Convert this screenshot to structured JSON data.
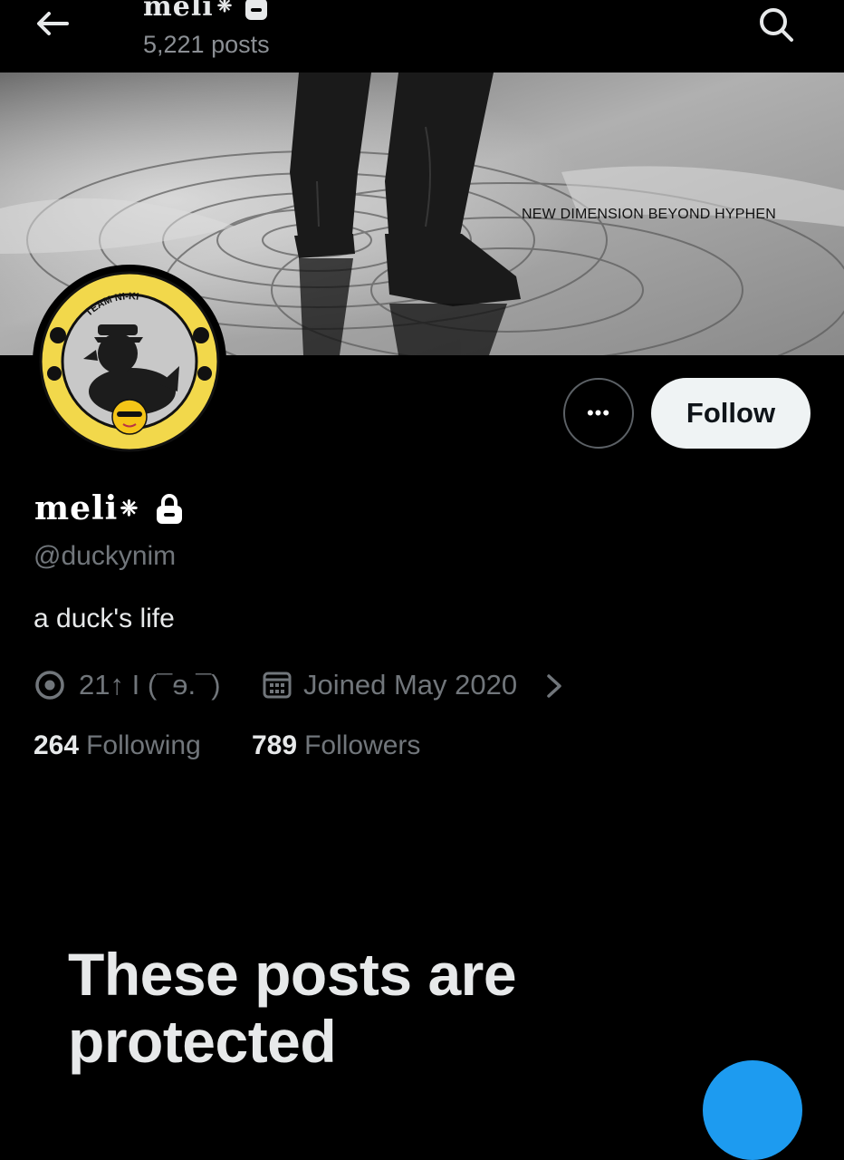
{
  "header": {
    "title": "meli",
    "title_glyph": "❈",
    "posts_count": "5,221 posts",
    "back_icon": "arrow-left-icon",
    "search_icon": "search-icon"
  },
  "banner": {
    "caption": "NEW DIMENSION BEYOND HYPHEN"
  },
  "avatar": {
    "ring_text": "TEAM NI-KI",
    "ring_color": "#f2d84b"
  },
  "actions": {
    "more_label": "•••",
    "follow_label": "Follow"
  },
  "profile": {
    "display_name": "meli",
    "name_glyph": "❈",
    "handle": "@duckynim",
    "bio": "a duck's life",
    "location": "21↑ I (¯ɘ.¯)",
    "joined": "Joined May 2020"
  },
  "stats": {
    "following_count": "264",
    "following_label": "Following",
    "followers_count": "789",
    "followers_label": "Followers"
  },
  "protected": {
    "title": "These posts are protected"
  },
  "colors": {
    "background": "#000000",
    "muted_text": "#71767b",
    "follow_button_bg": "#eff3f4",
    "accent": "#1d9bf0"
  }
}
